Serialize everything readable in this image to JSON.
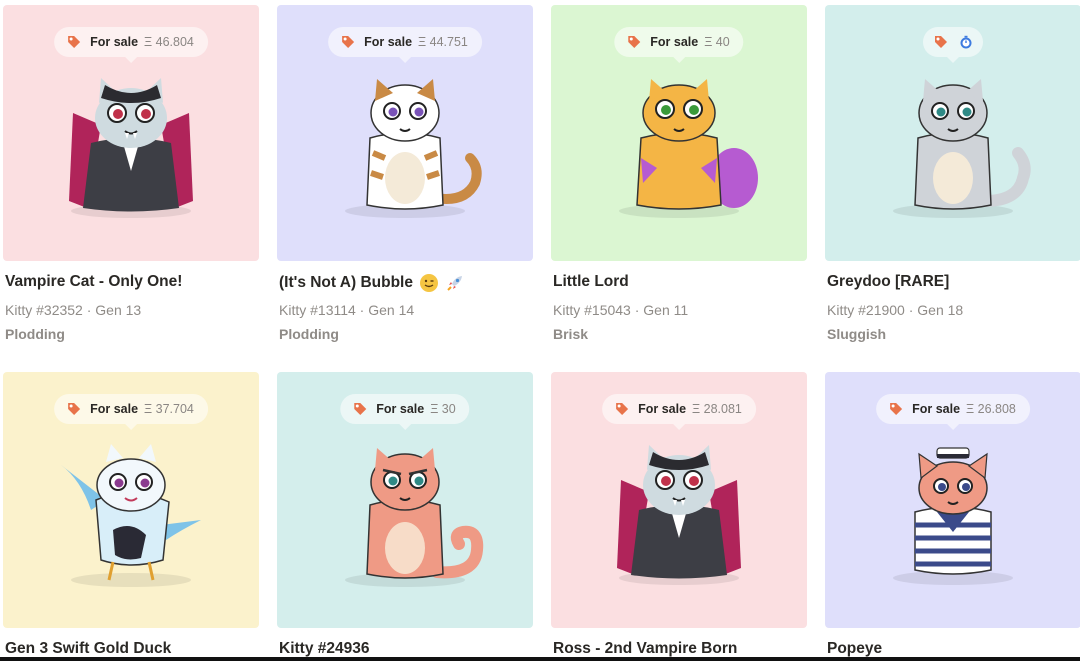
{
  "cards": [
    {
      "title": "Vampire Cat - Only One!",
      "kitty_id": "Kitty #32352",
      "gen": "Gen 13",
      "speed": "Plodding",
      "for_sale": "For sale",
      "price": "Ξ 46.804",
      "bg": "#fbdfe1",
      "cat": "vampire-cat"
    },
    {
      "title": "(It's Not A) Bubble",
      "kitty_id": "Kitty #13114",
      "gen": "Gen 14",
      "speed": "Plodding",
      "for_sale": "For sale",
      "price": "Ξ 44.751",
      "bg": "#dfdffb",
      "cat": "calico-cat",
      "emoji": [
        "wink-face-icon",
        "rocket-icon"
      ]
    },
    {
      "title": "Little Lord",
      "kitty_id": "Kitty #15043",
      "gen": "Gen 11",
      "speed": "Brisk",
      "for_sale": "For sale",
      "price": "Ξ 40",
      "bg": "#dbf6d2",
      "cat": "orange-purple-cat"
    },
    {
      "title": "Greydoo [RARE]",
      "kitty_id": "Kitty #21900",
      "gen": "Gen 18",
      "speed": "Sluggish",
      "for_sale": "",
      "price": "",
      "bg": "#d3eeec",
      "cat": "grey-cat",
      "timer": true
    },
    {
      "title": "Gen 3 Swift Gold Duck",
      "kitty_id": "",
      "gen": "",
      "speed": "",
      "for_sale": "For sale",
      "price": "Ξ 37.704",
      "bg": "#fbf2cc",
      "cat": "bird-cat"
    },
    {
      "title": "Kitty #24936",
      "kitty_id": "",
      "gen": "",
      "speed": "",
      "for_sale": "For sale",
      "price": "Ξ 30",
      "bg": "#d4eeec",
      "cat": "salmon-cat"
    },
    {
      "title": "Ross - 2nd Vampire Born",
      "kitty_id": "",
      "gen": "",
      "speed": "",
      "for_sale": "For sale",
      "price": "Ξ 28.081",
      "bg": "#fbdfe1",
      "cat": "vampire-cat"
    },
    {
      "title": "Popeye",
      "kitty_id": "",
      "gen": "",
      "speed": "",
      "for_sale": "For sale",
      "price": "Ξ 26.808",
      "bg": "#dfdffb",
      "cat": "sailor-cat"
    }
  ],
  "colors": {
    "text": "#2a2825",
    "muted": "#8f8b87",
    "tag_orange": "#e8734a",
    "timer_blue": "#3d7be0"
  }
}
